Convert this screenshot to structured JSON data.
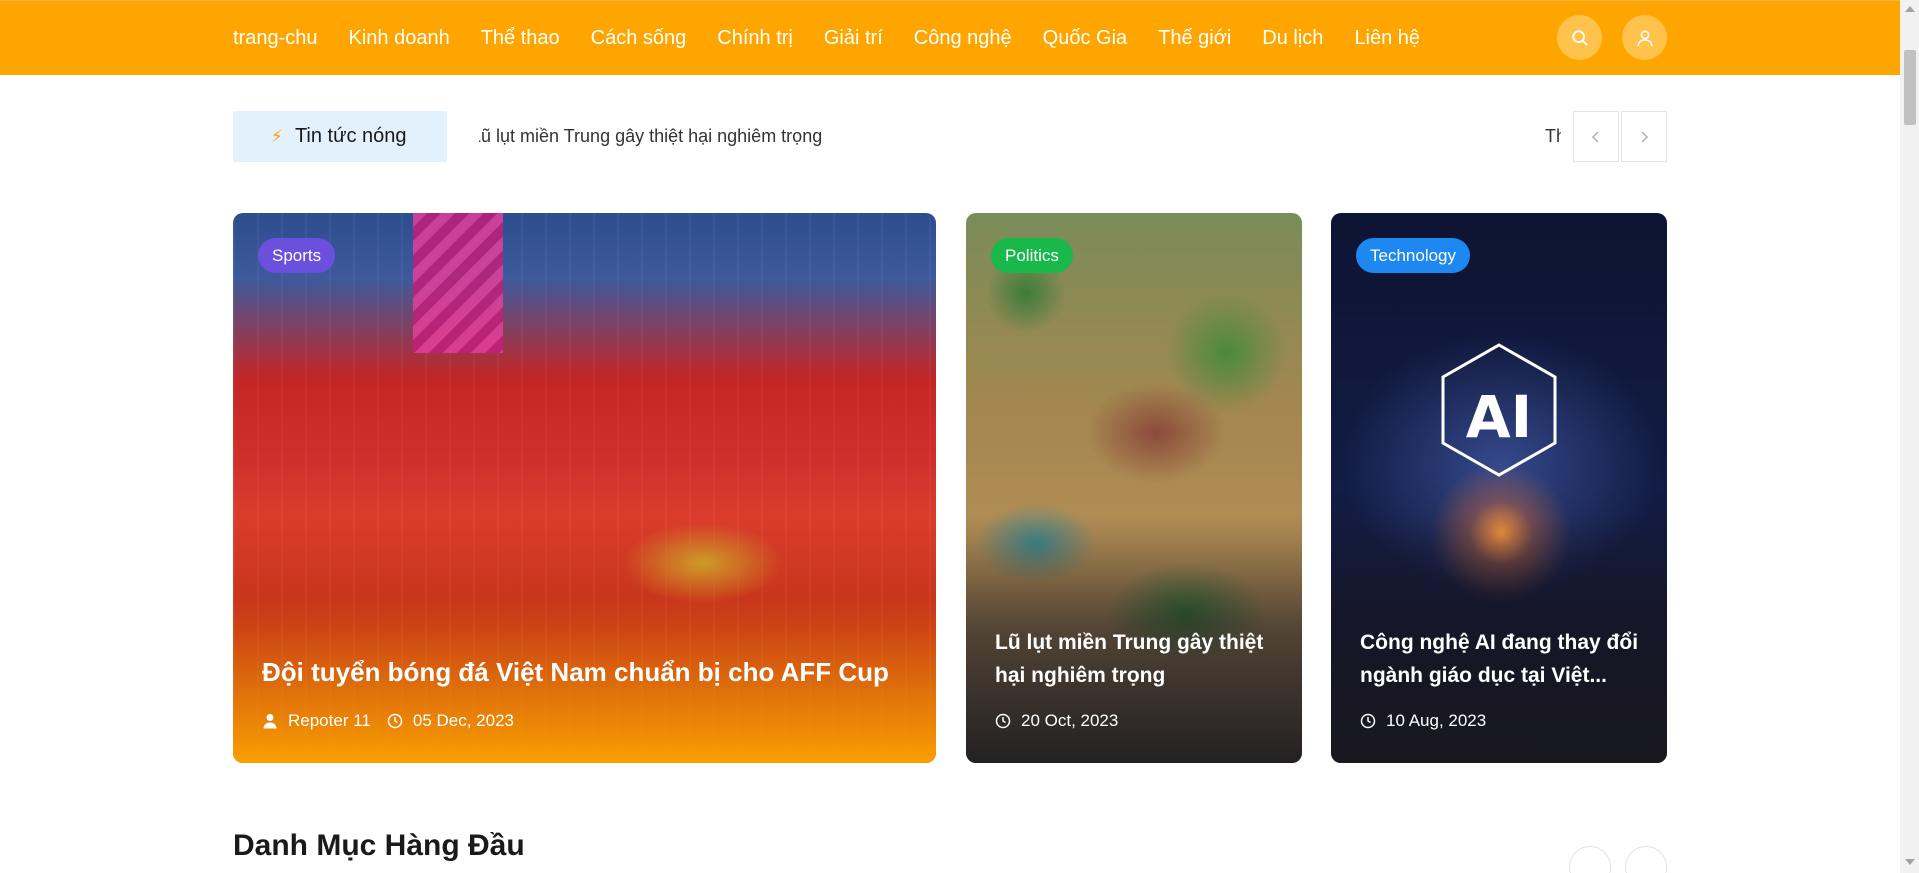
{
  "nav": {
    "items": [
      "trang-chu",
      "Kinh doanh",
      "Thể thao",
      "Cách sống",
      "Chính trị",
      "Giải trí",
      "Công nghệ",
      "Quốc Gia",
      "Thế giới",
      "Du lịch",
      "Liên hệ"
    ],
    "search_icon": "search-icon",
    "user_icon": "user-icon",
    "bg_color": "#ffa500"
  },
  "ticker": {
    "label": "Tin tức nóng",
    "label_icon": "lightning-icon",
    "text": "Lũ lụt miền Trung gây thiệt hại nghiêm trọng",
    "next_text": "Thể"
  },
  "cards": [
    {
      "category": "Sports",
      "title": "Đội tuyển bóng đá Việt Nam chuẩn bị cho AFF Cup",
      "author": "Repoter 11",
      "date": "05 Dec, 2023",
      "badge_color": "#6c4fdc"
    },
    {
      "category": "Politics",
      "title": "Lũ lụt miền Trung gây thiệt hại nghiêm trọng",
      "date": "20 Oct, 2023",
      "badge_color": "#18b84a"
    },
    {
      "category": "Technology",
      "title": "Công nghệ AI đang thay đổi ngành giáo dục tại Việt...",
      "image_text": "AI",
      "date": "10 Aug, 2023",
      "badge_color": "#1e88f2"
    }
  ],
  "section": {
    "title": "Danh Mục Hàng Đầu"
  }
}
